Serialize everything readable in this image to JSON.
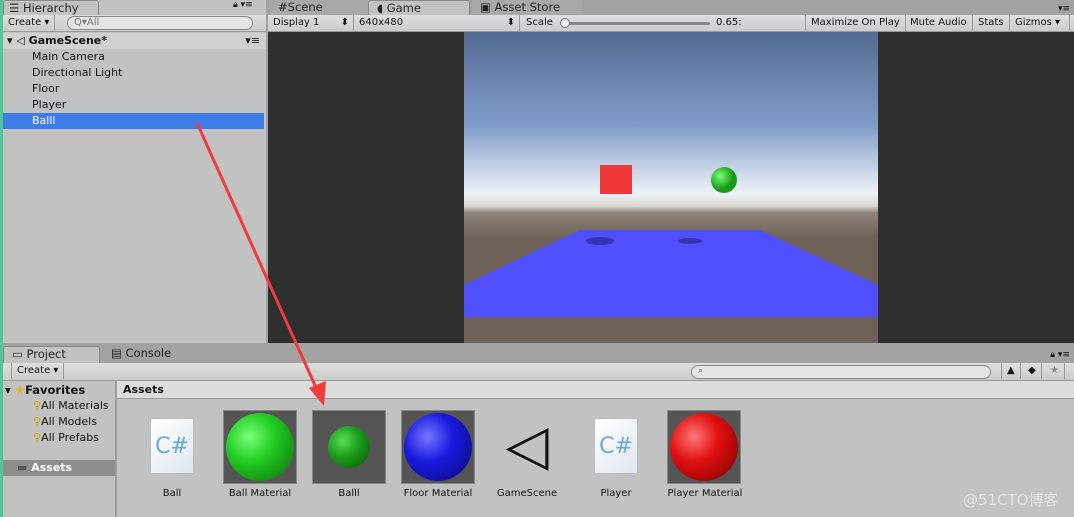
{
  "hierarchy": {
    "tab": "Hierarchy",
    "create": "Create",
    "search_placeholder": "All",
    "scene": "GameScene*",
    "items": [
      "Main Camera",
      "Directional Light",
      "Floor",
      "Player",
      "Balll"
    ],
    "selected": "Balll"
  },
  "game": {
    "tabs": [
      "Scene",
      "Game",
      "Asset Store"
    ],
    "active_tab": "Game",
    "display": "Display 1",
    "resolution": "640x480",
    "scale_label": "Scale",
    "scale_value": "0.65:",
    "buttons": [
      "Maximize On Play",
      "Mute Audio",
      "Stats",
      "Gizmos"
    ]
  },
  "project": {
    "tabs": [
      "Project",
      "Console"
    ],
    "create": "Create",
    "favorites": {
      "label": "Favorites",
      "items": [
        "All Materials",
        "All Models",
        "All Prefabs"
      ]
    },
    "assets_folder": "Assets",
    "breadcrumb": "Assets",
    "assets": [
      {
        "name": "Ball",
        "type": "script"
      },
      {
        "name": "Ball Material",
        "type": "material",
        "color": "#22cc22"
      },
      {
        "name": "Balll",
        "type": "prefab",
        "color": "#1a9a1a"
      },
      {
        "name": "Floor Material",
        "type": "material",
        "color": "#1a1ae0"
      },
      {
        "name": "GameScene",
        "type": "scene"
      },
      {
        "name": "Player",
        "type": "script"
      },
      {
        "name": "Player Material",
        "type": "material",
        "color": "#e01010"
      }
    ]
  },
  "watermark": "@51CTO博客",
  "colors": {
    "selection": "#3e7de7",
    "arrow": "#f03c3c",
    "floor": "#5050ff"
  }
}
